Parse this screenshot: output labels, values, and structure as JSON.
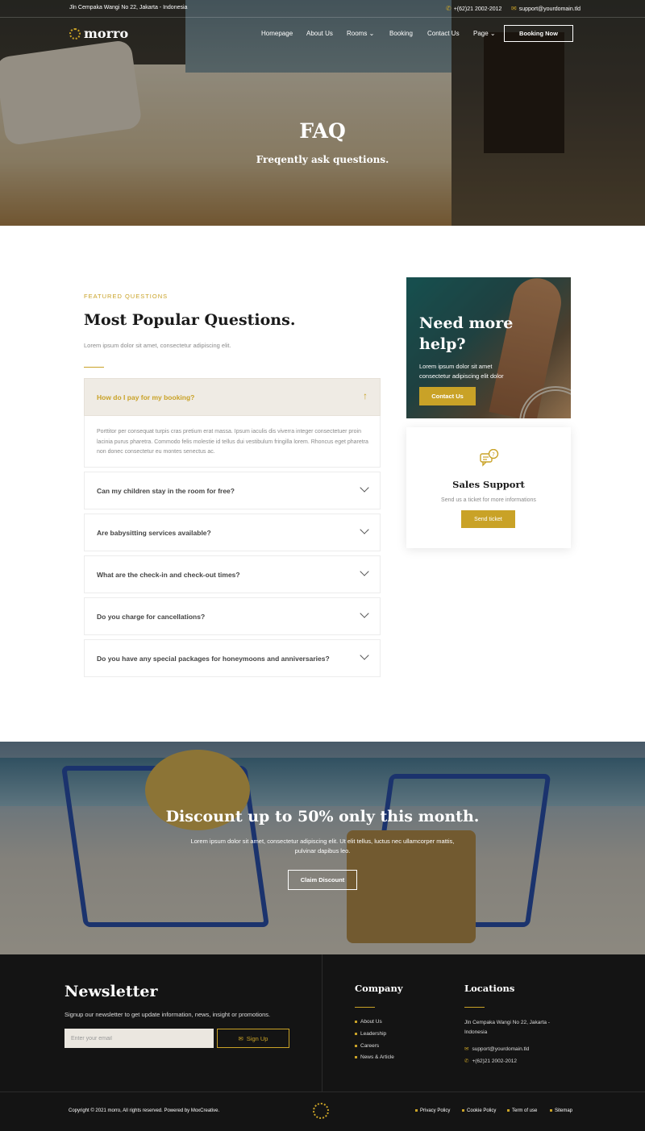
{
  "topbar": {
    "address": "Jln Cempaka Wangi No 22, Jakarta - Indonesia",
    "phone": "+(62)21 2002-2012",
    "email": "support@yourdomain.tld"
  },
  "brand": {
    "name": "morro"
  },
  "nav": {
    "items": [
      "Homepage",
      "About Us",
      "Rooms",
      "Booking",
      "Contact Us",
      "Page"
    ],
    "booking_button": "Booking Now"
  },
  "hero": {
    "title": "FAQ",
    "subtitle": "Freqently ask questions."
  },
  "faq": {
    "eyebrow": "FEATURED QUESTIONS",
    "title": "Most Popular Questions.",
    "description": "Lorem ipsum dolor sit amet, consectetur adipiscing elit.",
    "open_item": {
      "question": "How do I pay for my booking?",
      "answer": "Porttitor per consequat turpis cras pretium erat massa. Ipsum iaculis dis viverra integer consectetuer proin lacinia purus pharetra. Commodo felis molestie id tellus dui vestibulum fringilla lorem. Rhoncus eget pharetra non donec consectetur eu montes senectus ac."
    },
    "items": [
      "Can my children stay in the room for free?",
      "Are babysitting services available?",
      "What are the check-in and check-out times?",
      "Do you charge for cancellations?",
      "Do you have any special packages for honeymoons and anniversaries?"
    ]
  },
  "help_card": {
    "title": "Need more help?",
    "text": "Lorem ipsum dolor sit amet consectetur adipiscing elit dolor",
    "button": "Contact Us"
  },
  "support_card": {
    "title": "Sales Support",
    "text": "Send us a ticket for more informations",
    "button": "Send ticket"
  },
  "discount": {
    "title": "Discount up to 50% only this month.",
    "text": "Lorem ipsum dolor sit amet, consectetur adipiscing elit. Ut elit tellus, luctus nec ullamcorper mattis, pulvinar dapibus leo.",
    "button": "Claim Discount"
  },
  "newsletter": {
    "title": "Newsletter",
    "text": "Signup our newsletter to get update information, news, insight or promotions.",
    "placeholder": "Enter your email",
    "button": "Sign Up"
  },
  "company": {
    "title": "Company",
    "links": [
      "About Us",
      "Leadership",
      "Careers",
      "News & Article"
    ]
  },
  "locations": {
    "title": "Locations",
    "address": "Jln Cempaka Wangi No 22, Jakarta - Indonesia",
    "email": "support@yourdomain.tld",
    "phone": "+(62)21 2002-2012"
  },
  "footer": {
    "copyright": "Copyright © 2021 morro, All rights reserved. Powered by MoxCreative.",
    "links": [
      "Privacy Policy",
      "Cookie Policy",
      "Term of use",
      "Sitemap"
    ]
  },
  "colors": {
    "accent": "#c9a227",
    "dark": "#141414",
    "open_bg": "#efebe4"
  }
}
